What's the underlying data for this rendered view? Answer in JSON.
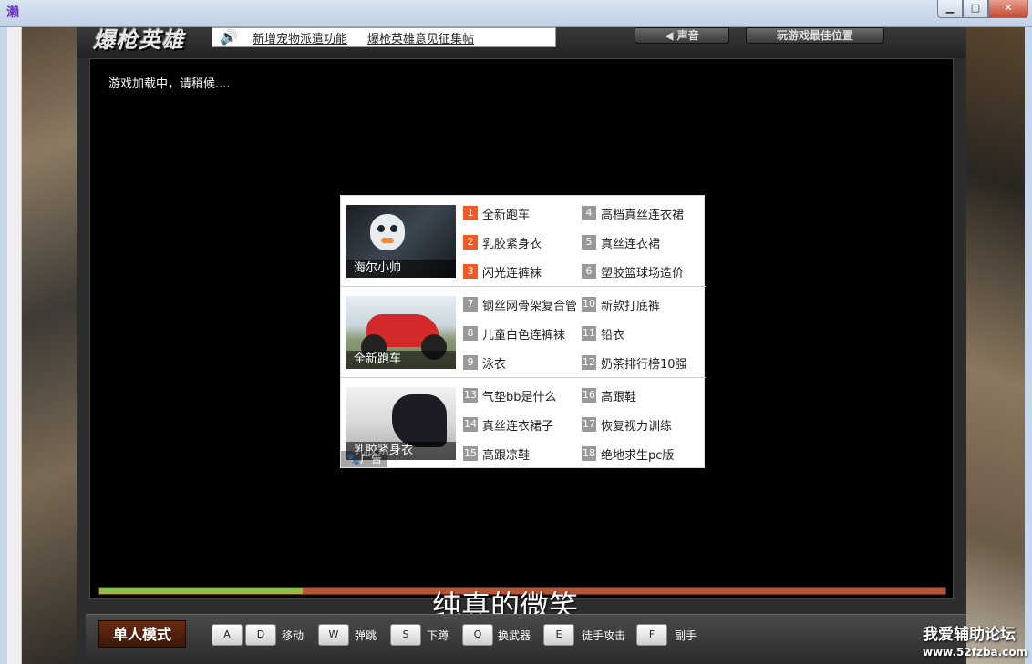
{
  "window": {
    "icon_glyph": "濑",
    "minimize": "▁",
    "maximize": "□",
    "close": "✕"
  },
  "header": {
    "logo": "爆枪英雄",
    "notices": [
      "新增宠物派遣功能",
      "爆枪英雄意见征集帖"
    ],
    "sound_label": "◀ 声音",
    "best_position_label": "玩游戏最佳位置"
  },
  "stage": {
    "loading_text": "游戏加载中，请稍候...."
  },
  "ad": {
    "badge": "广告",
    "rows": [
      {
        "thumb_label": "海尔小帅",
        "items": [
          {
            "n": "1",
            "text": "全新跑车",
            "hot": true
          },
          {
            "n": "4",
            "text": "高档真丝连衣裙",
            "hot": false
          },
          {
            "n": "2",
            "text": "乳胶紧身衣",
            "hot": true
          },
          {
            "n": "5",
            "text": "真丝连衣裙",
            "hot": false
          },
          {
            "n": "3",
            "text": "闪光连裤袜",
            "hot": true
          },
          {
            "n": "6",
            "text": "塑胶篮球场造价",
            "hot": false
          }
        ]
      },
      {
        "thumb_label": "全新跑车",
        "items": [
          {
            "n": "7",
            "text": "钢丝网骨架复合管",
            "hot": false
          },
          {
            "n": "10",
            "text": "新款打底裤",
            "hot": false
          },
          {
            "n": "8",
            "text": "儿童白色连裤袜",
            "hot": false
          },
          {
            "n": "11",
            "text": "铅衣",
            "hot": false
          },
          {
            "n": "9",
            "text": "泳衣",
            "hot": false
          },
          {
            "n": "12",
            "text": "奶茶排行榜10强",
            "hot": false
          }
        ]
      },
      {
        "thumb_label": "乳胶紧身衣",
        "items": [
          {
            "n": "13",
            "text": "气垫bb是什么",
            "hot": false
          },
          {
            "n": "16",
            "text": "高跟鞋",
            "hot": false
          },
          {
            "n": "14",
            "text": "真丝连衣裙子",
            "hot": false
          },
          {
            "n": "17",
            "text": "恢复视力训练",
            "hot": false
          },
          {
            "n": "15",
            "text": "高跟凉鞋",
            "hot": false
          },
          {
            "n": "18",
            "text": "绝地求生pc版",
            "hot": false
          }
        ]
      }
    ]
  },
  "progress": {
    "value": 0.24
  },
  "overlay": {
    "caption": "纯真的微笑"
  },
  "controls": {
    "mode": "单人模式",
    "keys": [
      "A",
      "D",
      "W",
      "S",
      "Q",
      "E",
      "F"
    ],
    "labels": [
      "移动",
      "弹跳",
      "下蹲",
      "换武器",
      "徒手攻击",
      "副手"
    ]
  },
  "site_watermark": {
    "name": "我爱辅助论坛",
    "url": "www.52fzba.com"
  },
  "colors": {
    "hot_badge": "#f15a22",
    "progress_fill": "#8cbf4a",
    "progress_track": "#b25637",
    "mode_badge": "#6b2c14"
  }
}
